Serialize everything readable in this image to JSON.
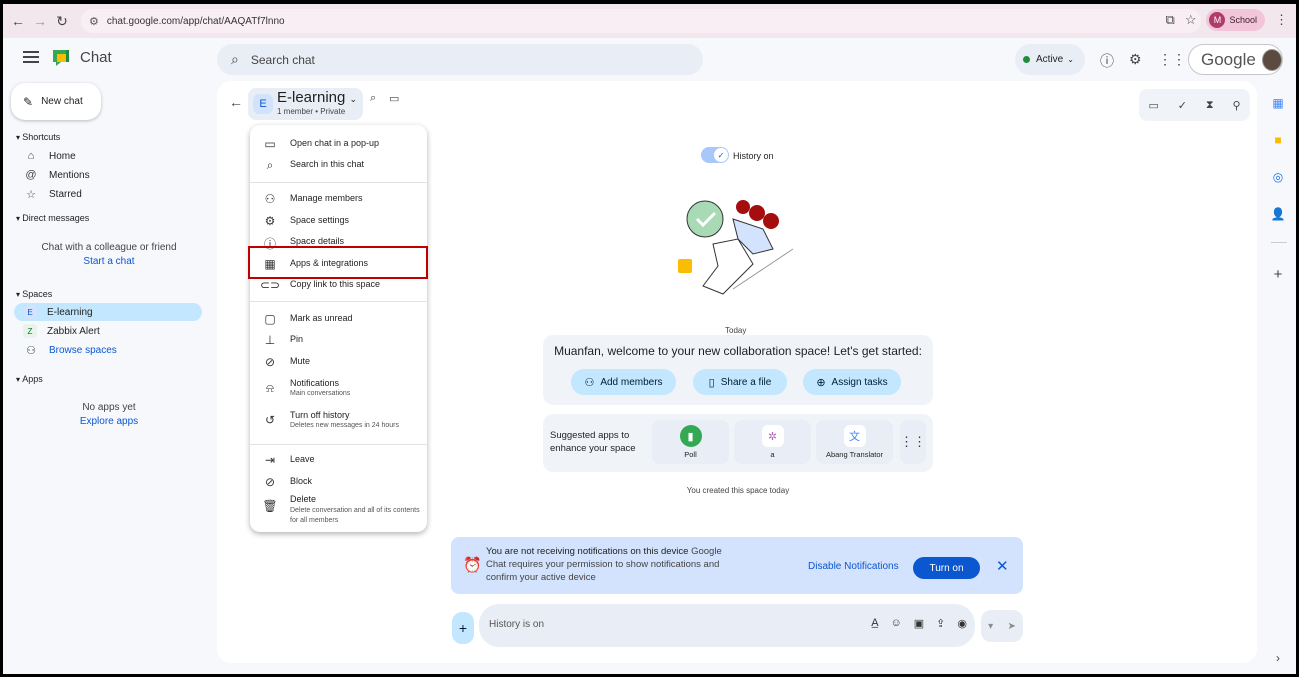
{
  "browser": {
    "url": "chat.google.com/app/chat/AAQATf7lnno",
    "profile_initial": "M",
    "profile_label": "School"
  },
  "header": {
    "app_title": "Chat",
    "search_placeholder": "Search chat",
    "status_label": "Active",
    "google_label": "Google"
  },
  "sidebar": {
    "new_chat_label": "New chat",
    "shortcuts_header": "Shortcuts",
    "shortcuts": [
      {
        "label": "Home",
        "icon": "home-icon"
      },
      {
        "label": "Mentions",
        "icon": "at-icon"
      },
      {
        "label": "Starred",
        "icon": "star-icon"
      }
    ],
    "dm_header": "Direct messages",
    "dm_empty_text": "Chat with a colleague or friend",
    "dm_link": "Start a chat",
    "spaces_header": "Spaces",
    "spaces": [
      {
        "initial": "E",
        "label": "E-learning"
      },
      {
        "initial": "Z",
        "label": "Zabbix Alert"
      }
    ],
    "browse_spaces": "Browse spaces",
    "apps_header": "Apps",
    "apps_empty_text": "No apps yet",
    "apps_link": "Explore apps"
  },
  "space": {
    "initial": "E",
    "name": "E-learning",
    "member_info": "1 member",
    "privacy": "Private"
  },
  "menu": {
    "items": [
      {
        "label": "Open chat in a pop-up",
        "icon": "popup-icon"
      },
      {
        "label": "Search in this chat",
        "icon": "search-icon"
      },
      {
        "label": "Manage members",
        "icon": "people-icon"
      },
      {
        "label": "Space settings",
        "icon": "settings-icon"
      },
      {
        "label": "Space details",
        "icon": "info-icon"
      },
      {
        "label": "Apps & integrations",
        "icon": "apps-icon"
      },
      {
        "label": "Copy link to this space",
        "icon": "link-icon"
      },
      {
        "label": "Mark as unread",
        "icon": "unread-icon"
      },
      {
        "label": "Pin",
        "icon": "pin-icon"
      },
      {
        "label": "Mute",
        "icon": "mute-icon"
      },
      {
        "label": "Notifications",
        "sub": "Main conversations",
        "icon": "bell-icon"
      },
      {
        "label": "Turn off history",
        "sub": "Deletes new messages in 24 hours",
        "icon": "history-off-icon"
      },
      {
        "label": "Leave",
        "icon": "leave-icon"
      },
      {
        "label": "Block",
        "icon": "block-icon"
      },
      {
        "label": "Delete",
        "sub": "Delete conversation and all of its contents for all members",
        "icon": "trash-icon"
      }
    ]
  },
  "content": {
    "history_label": "History on",
    "today_label": "Today",
    "welcome_text": "Muanfan, welcome to your new collaboration space! Let's get started:",
    "actions": [
      "Add members",
      "Share a file",
      "Assign tasks"
    ],
    "suggested_text": "Suggested apps to enhance your space",
    "apps": [
      {
        "label": "Poll",
        "color": "#34a853"
      },
      {
        "label": "a",
        "color": "#b06ab3"
      },
      {
        "label": "Abang Translator",
        "color": "#4285f4"
      }
    ],
    "created_text": "You created this space today"
  },
  "notification": {
    "title": "You are not receiving notifications on this device",
    "body": "Google Chat requires your permission to show notifications and confirm your active device",
    "disable_label": "Disable Notifications",
    "turn_on_label": "Turn on"
  },
  "composer": {
    "placeholder": "History is on"
  },
  "colors": {
    "accent": "#0b57d0",
    "highlight_box": "#c00000",
    "active_space_bg": "#c2e7ff"
  }
}
